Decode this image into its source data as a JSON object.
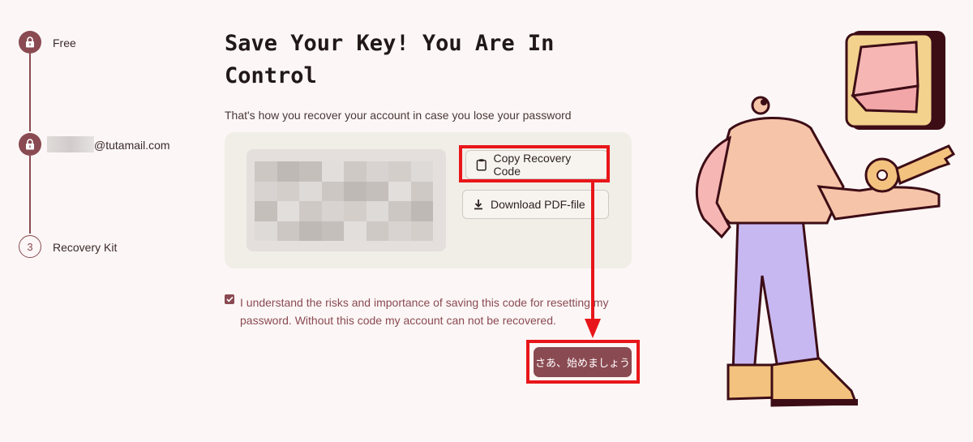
{
  "stepper": {
    "steps": [
      {
        "label": "Free",
        "icon": "lock-icon"
      },
      {
        "label": "@tutamail.com",
        "icon": "lock-icon"
      },
      {
        "label": "Recovery Kit",
        "number": "3"
      }
    ]
  },
  "main": {
    "title": "Save Your Key! You Are In Control",
    "subtitle": "That's how you recover your account in case you lose your password",
    "buttons": {
      "copy": "Copy Recovery Code",
      "download": "Download PDF-file"
    },
    "consent": {
      "checked": true,
      "text": "I understand the risks and importance of saving this code for resetting my password. Without this code my account can not be recovered."
    },
    "start_button": "さあ、始めましょう"
  },
  "colors": {
    "accent": "#8a4a52",
    "background": "#fcf7f6",
    "panel": "#f1ede7",
    "annotation": "#e8161a"
  }
}
